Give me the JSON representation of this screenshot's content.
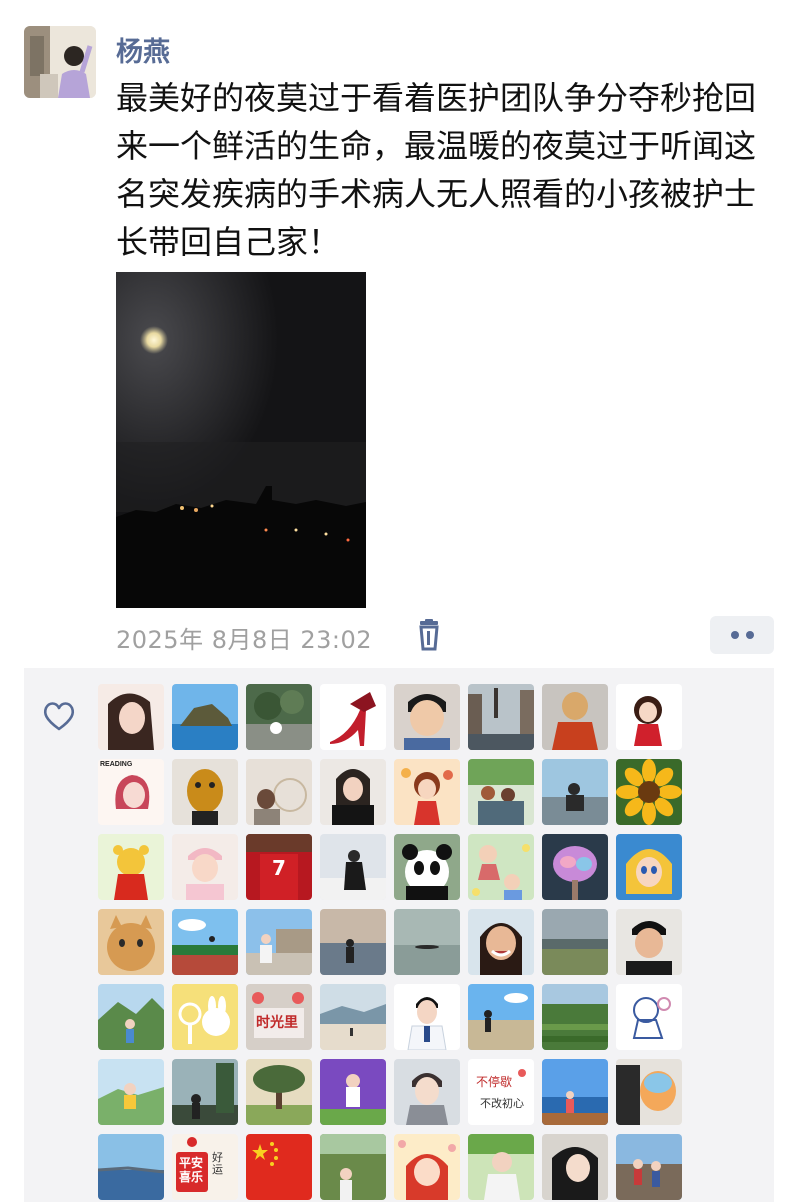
{
  "post": {
    "author": "杨燕",
    "text": "最美好的夜莫过于看着医护团队争分夺秒抢回来一个鲜活的生命，最温暖的夜莫过于听闻这名突发疾病的手术病人无人照看的小孩被护士长带回自己家！",
    "timestamp": "2025年 8月8日 23:02",
    "icons": {
      "delete": "trash-icon",
      "more": "more-dots-icon",
      "like": "heart-icon"
    },
    "colors": {
      "name": "#576b95",
      "time": "#a0a0a0",
      "panel": "#f3f3f5"
    }
  },
  "likes": {
    "avatar_texts": {
      "reading": "READING",
      "shirt_number": "7",
      "sign_1": "不停歇",
      "sign_2": "不改初心",
      "red_card": "平安喜乐",
      "fortune": "好运",
      "building": "时光里"
    }
  }
}
